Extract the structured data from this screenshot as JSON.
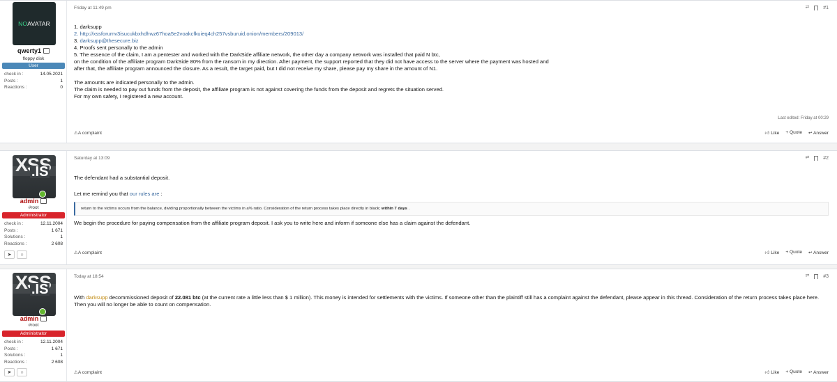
{
  "posts": [
    {
      "date": "Friday at 11:49 pm",
      "number": "#1",
      "avatar": {
        "prefix": "NO",
        "rest": " AVATAR"
      },
      "username": "qwerty1",
      "user_title": "floppy disk",
      "banner": "User",
      "stats": [
        {
          "label": "check in :",
          "value": "14.05.2021"
        },
        {
          "label": "Posts :",
          "value": "1"
        },
        {
          "label": "Reactions :",
          "value": "0"
        }
      ],
      "lines": [
        "1. darksupp",
        "2. http://xssforumv3isucukbxhdhwz67hoa5e2voakcfkuieq4ch257vsburuid.onion/members/209013/",
        "3. darksupp@thesecure.biz",
        "4. Proofs sent personally to the admin",
        "5. The essence of the claim, I am a pentester and worked with the DarkSide affiliate network, the other day a company network was installed that paid N btc,",
        "on the condition of the affiliate program DarkSide 80% from the ransom in my direction. After payment, the support reported that they did not have access to the server where the payment was hosted and",
        "after that, the affiliate program announced the closure. As a result, the target paid, but I did not receive my share, please pay my share in the amount of N1.",
        "The amounts are indicated personally to the admin.",
        "The claim is needed to pay out funds from the deposit, the affiliate program is not against covering the funds from the deposit and regrets the situation served.",
        "For my own safety, I registered a new account."
      ],
      "last_edited": "Last edited: Friday at 00:29",
      "complaint": "A complaint",
      "like": "Like",
      "quote": "+ Quote",
      "answer": "Answer"
    },
    {
      "date": "Saturday at 13:09",
      "number": "#2",
      "username": "admin",
      "user_title": "#root",
      "banner": "Administrator",
      "stats": [
        {
          "label": "check in :",
          "value": "12.11.2004"
        },
        {
          "label": "Posts :",
          "value": "1 671"
        },
        {
          "label": "Solutions :",
          "value": "1"
        },
        {
          "label": "Reactions :",
          "value": "2 608"
        }
      ],
      "line1": "The defendant had a substantial deposit.",
      "line2_prefix": "Let me remind you that ",
      "line2_link": "our rules are",
      "line2_suffix": " :",
      "quote_text": "return to the victims occurs from the balance, dividing proportionally between the victims in a% ratio. Consideration of the return process takes place directly in black; ",
      "quote_bold": "within 7 days",
      "quote_end": " .",
      "line3": "We begin the procedure for paying compensation from the affiliate program deposit. I ask you to write here and inform if someone else has a claim against the defendant.",
      "complaint": "A complaint",
      "like": "Like",
      "quote": "+ Quote",
      "answer": "Answer"
    },
    {
      "date": "Today at 18:54",
      "number": "#3",
      "username": "admin",
      "user_title": "#root",
      "banner": "Administrator",
      "stats": [
        {
          "label": "check in :",
          "value": "12.11.2004"
        },
        {
          "label": "Posts :",
          "value": "1 671"
        },
        {
          "label": "Solutions :",
          "value": "1"
        },
        {
          "label": "Reactions :",
          "value": "2 608"
        }
      ],
      "t_with": "With ",
      "t_user": "darksupp",
      "t_mid": " decommissioned deposit of ",
      "t_amount": "22.081 btc",
      "t_rest": " (at the current rate a little less than $ 1 million). This money is intended for settlements with the victims. If someone other than the plaintiff still has a complaint against the defendant, please appear in this thread. Consideration of the return process takes place here. Then you will no longer be able to count on compensation.",
      "complaint": "A complaint",
      "like": "Like",
      "quote": "+ Quote",
      "answer": "Answer"
    }
  ],
  "avatar_text": {
    "xss": "XSS",
    "is": ".IS"
  },
  "icons": {
    "share": "share-icon",
    "bookmark": "bookmark-icon",
    "telegram": "telegram-icon",
    "map": "location-icon"
  }
}
